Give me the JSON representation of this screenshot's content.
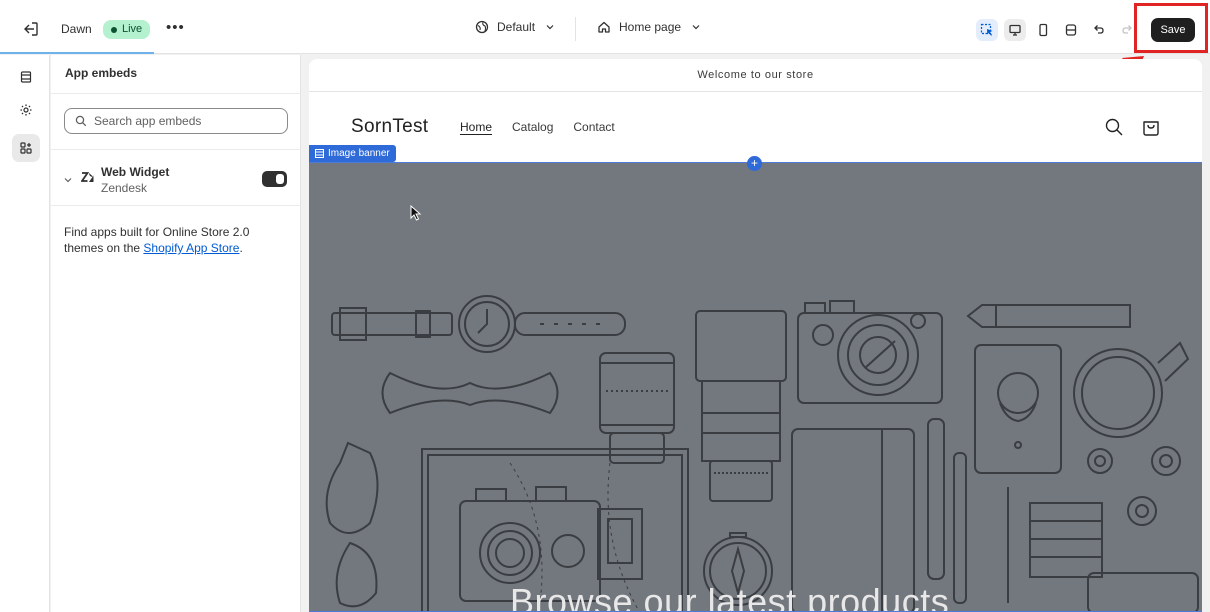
{
  "topbar": {
    "theme_name": "Dawn",
    "live_label": "Live",
    "more_label": "•••",
    "template_picker": "Default",
    "page_picker": "Home page",
    "save_label": "Save"
  },
  "sidebar": {
    "title": "App embeds",
    "search_placeholder": "Search app embeds",
    "embeds": [
      {
        "name": "Web Widget",
        "provider": "Zendesk",
        "enabled": true
      }
    ],
    "help_text": "Find apps built for Online Store 2.0 themes on the ",
    "help_link": "Shopify App Store",
    "help_suffix": "."
  },
  "preview": {
    "announcement": "Welcome to our store",
    "store_name": "SornTest",
    "nav": [
      "Home",
      "Catalog",
      "Contact"
    ],
    "section_tag": "Image banner",
    "banner_heading": "Browse our latest products"
  },
  "colors": {
    "save_bg": "#1f1f1f",
    "live_badge": "#b4f1cf",
    "selection_blue": "#2f6ad9",
    "highlight_red": "#e02424"
  }
}
